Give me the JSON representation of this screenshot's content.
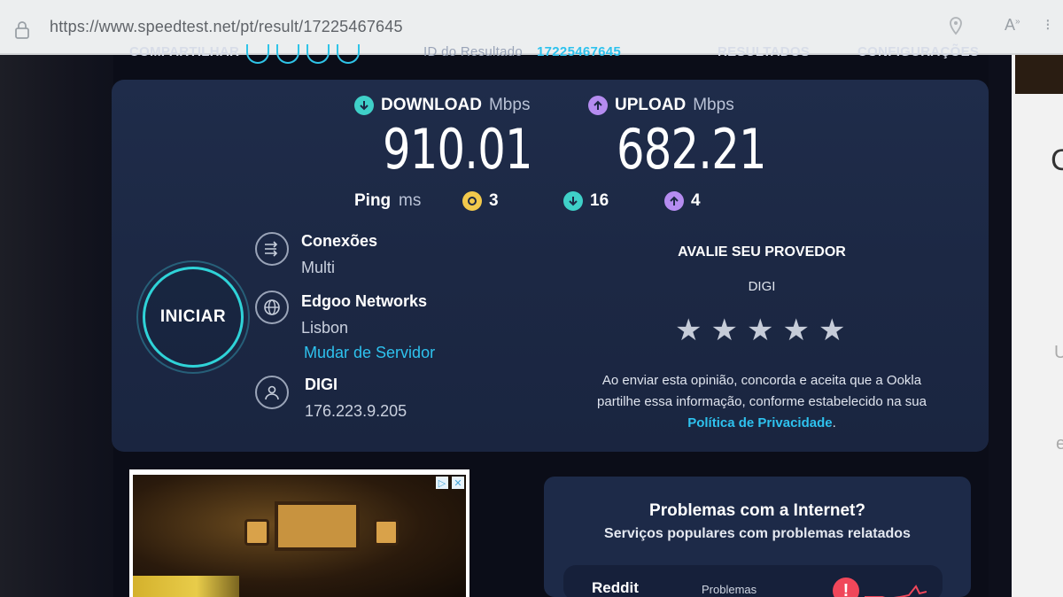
{
  "browser": {
    "url": "https://www.speedtest.net/pt/result/17225467645"
  },
  "nav": {
    "share_label": "COMPARTILHAR",
    "result_id_label": "ID do Resultado",
    "result_id": "17225467645",
    "results_label": "RESULTADOS",
    "settings_label": "CONFIGURAÇÕES"
  },
  "result": {
    "download": {
      "label": "DOWNLOAD",
      "unit": "Mbps",
      "value": "910.01"
    },
    "upload": {
      "label": "UPLOAD",
      "unit": "Mbps",
      "value": "682.21"
    },
    "ping": {
      "label": "Ping",
      "unit": "ms",
      "idle": "3",
      "download": "16",
      "upload": "4"
    }
  },
  "start_button": {
    "label": "INICIAR"
  },
  "server": {
    "connections_title": "Conexões",
    "connections_value": "Multi",
    "host_name": "Edgoo Networks",
    "host_city": "Lisbon",
    "change_server": "Mudar de Servidor",
    "isp_name": "DIGI",
    "ip": "176.223.9.205"
  },
  "rating": {
    "title": "AVALIE SEU PROVEDOR",
    "provider": "DIGI",
    "stars": [
      "★",
      "★",
      "★",
      "★",
      "★"
    ],
    "note_line1": "Ao enviar esta opinião, concorda e aceita que a Ookla",
    "note_line2": "partilhe essa informação, conforme estabelecido na sua",
    "privacy_link": "Política de Privacidade",
    "note_end": "."
  },
  "problems": {
    "title": "Problemas com a Internet?",
    "subtitle": "Serviços populares com problemas relatados",
    "rows": [
      {
        "name": "Reddit",
        "label": "Problemas"
      }
    ]
  },
  "colors": {
    "accent_cyan": "#2ec2ee",
    "download_icon": "#3fd0c8",
    "upload_icon": "#b58cf0",
    "ping_icon": "#f2c94c",
    "alert": "#f0475a"
  }
}
